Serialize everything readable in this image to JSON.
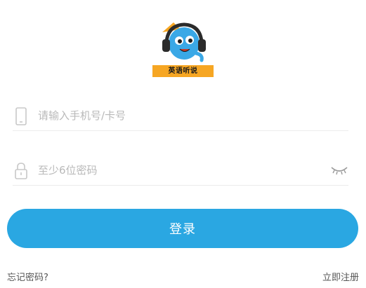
{
  "app": {
    "logo_text": "英语听说"
  },
  "phone_field": {
    "icon": "phone-icon",
    "placeholder": "请输入手机号/卡号",
    "value": ""
  },
  "password_field": {
    "icon": "lock-icon",
    "placeholder": "至少6位密码",
    "value": "",
    "toggle_icon": "eye-closed-icon"
  },
  "login_button": {
    "label": "登录"
  },
  "links": {
    "forgot_password": "忘记密码?",
    "register": "立即注册"
  },
  "colors": {
    "primary": "#2aa7e2",
    "logo_banner": "#f6a623",
    "placeholder": "#b9b9b9",
    "icon": "#c8c8c8"
  }
}
